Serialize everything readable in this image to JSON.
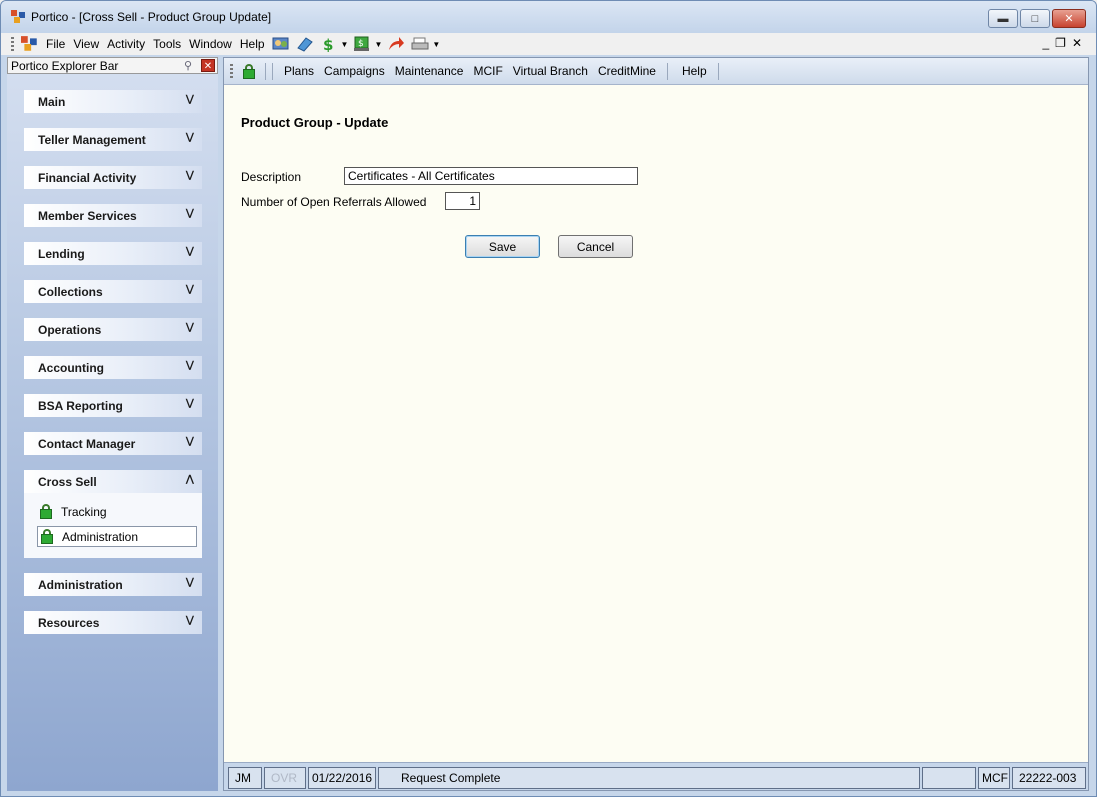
{
  "window": {
    "title": "Portico - [Cross Sell - Product Group Update]"
  },
  "menu": {
    "items": [
      "File",
      "View",
      "Activity",
      "Tools",
      "Window",
      "Help"
    ]
  },
  "explorer": {
    "title": "Portico Explorer Bar",
    "groups": [
      {
        "label": "Main"
      },
      {
        "label": "Teller Management"
      },
      {
        "label": "Financial Activity"
      },
      {
        "label": "Member Services"
      },
      {
        "label": "Lending"
      },
      {
        "label": "Collections"
      },
      {
        "label": "Operations"
      },
      {
        "label": "Accounting"
      },
      {
        "label": "BSA Reporting"
      },
      {
        "label": "Contact Manager"
      },
      {
        "label": "Cross Sell"
      },
      {
        "label": "Administration"
      },
      {
        "label": "Resources"
      }
    ],
    "cross_sell_items": [
      {
        "label": "Tracking"
      },
      {
        "label": "Administration"
      }
    ]
  },
  "nav": {
    "links": [
      "Plans",
      "Campaigns",
      "Maintenance",
      "MCIF",
      "Virtual Branch",
      "CreditMine"
    ],
    "help": "Help"
  },
  "form": {
    "title": "Product Group - Update",
    "description_label": "Description",
    "description_value": "Certificates - All Certificates",
    "referrals_label": "Number of Open Referrals Allowed",
    "referrals_value": "1",
    "save_label": "Save",
    "cancel_label": "Cancel"
  },
  "status": {
    "user": "JM",
    "ovr": "OVR",
    "date": "01/22/2016",
    "message": "Request Complete",
    "mcf": "MCF",
    "code": "22222-003"
  }
}
